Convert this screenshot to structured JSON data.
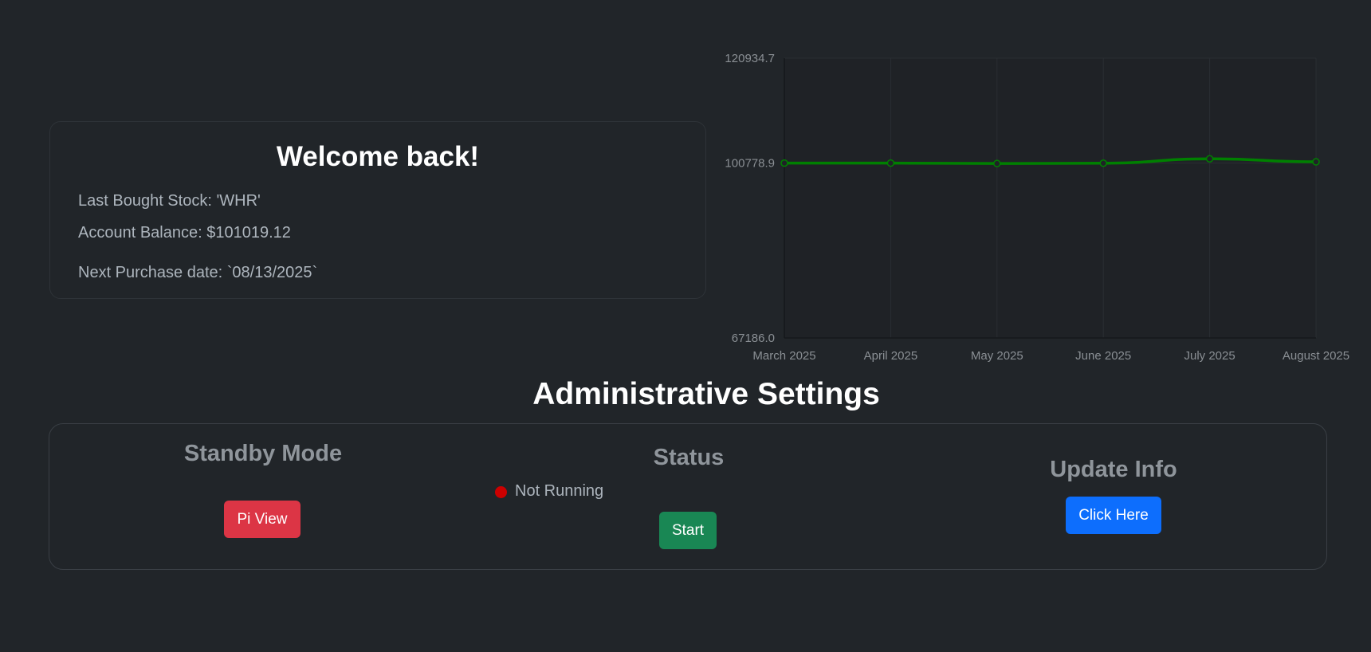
{
  "welcome": {
    "title": "Welcome back!",
    "last_bought": "Last Bought Stock: 'WHR'",
    "balance": "Account Balance: $101019.12",
    "next_purchase": "Next Purchase date: `08/13/2025`"
  },
  "chart_data": {
    "type": "line",
    "categories": [
      "March 2025",
      "April 2025",
      "May 2025",
      "June 2025",
      "July 2025",
      "August 2025"
    ],
    "series": [
      {
        "values": [
          100778.9,
          100780,
          100700,
          100760,
          101600,
          101019.12
        ]
      }
    ],
    "ylim": [
      67186.0,
      120934.7
    ],
    "yticks": [
      "120934.7",
      "100778.9",
      "67186.0"
    ],
    "ytick_values": [
      120934.7,
      100778.9,
      67186.0
    ],
    "line_color": "#008000",
    "grid": true
  },
  "admin": {
    "title": "Administrative Settings",
    "standby": {
      "title": "Standby Mode",
      "button": "Pi View",
      "color": "#dc3545"
    },
    "status": {
      "title": "Status",
      "state": "Not Running",
      "dot_color": "#cc0000",
      "button": "Start",
      "color": "#198754"
    },
    "update": {
      "title": "Update Info",
      "button": "Click Here",
      "color": "#0d6efd"
    }
  }
}
